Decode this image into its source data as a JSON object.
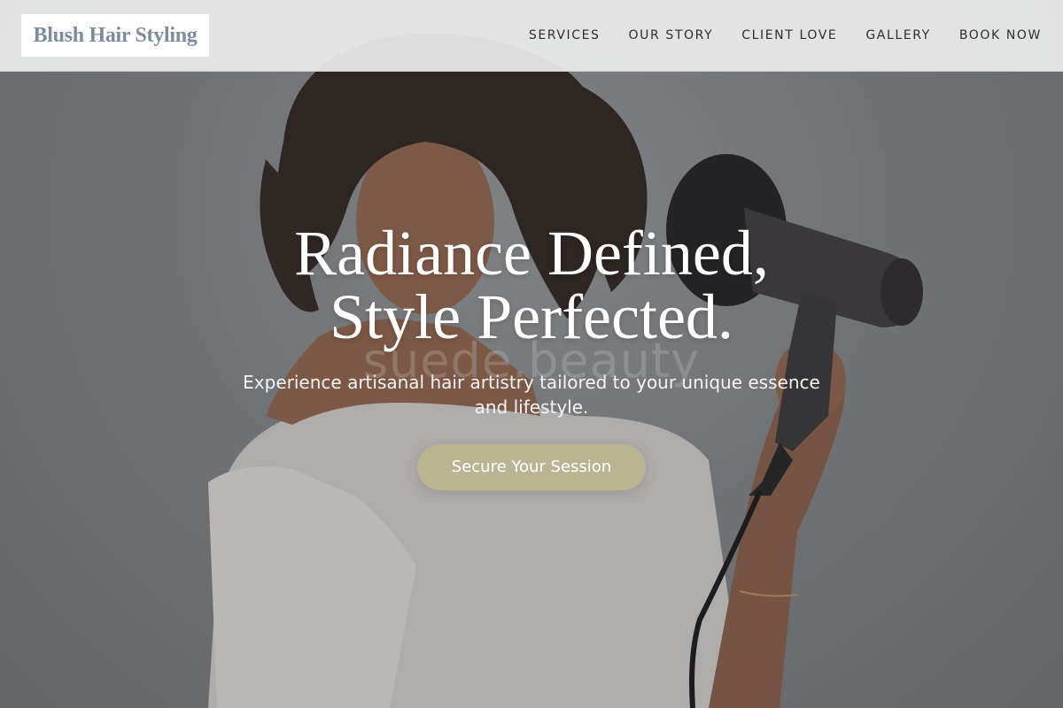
{
  "brand": {
    "name": "Blush Hair Styling",
    "color": "#7c8c9c"
  },
  "nav": {
    "items": [
      {
        "label": "SERVICES"
      },
      {
        "label": "OUR STORY"
      },
      {
        "label": "CLIENT LOVE"
      },
      {
        "label": "GALLERY"
      },
      {
        "label": "BOOK NOW"
      }
    ]
  },
  "hero": {
    "headline_line1": "Radiance Defined,",
    "headline_line2": "Style Perfected.",
    "watermark": "suede.beauty",
    "subhead": "Experience artisanal hair artistry tailored to your unique essence and lifestyle.",
    "cta_label": "Secure Your Session",
    "image_icon": "woman-with-hair-dryer-photo"
  },
  "colors": {
    "accent": "#b9b491",
    "header_bg": "#ececec",
    "text_dark": "#2c2e30"
  }
}
